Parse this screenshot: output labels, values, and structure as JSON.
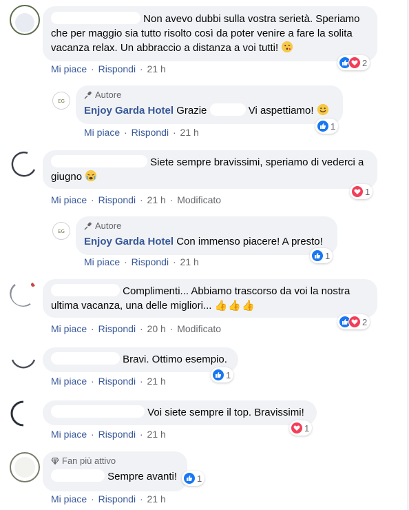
{
  "actions": {
    "like": "Mi piace",
    "reply": "Rispondi",
    "sep": "·",
    "edited": "Modificato"
  },
  "comments": [
    {
      "text": "Non avevo dubbi sulla vostra serietà. Speriamo che per maggio sia tutto risolto così da poter venire a fare la solita vacanza relax. Un abbraccio a distanza a voi tutti!",
      "time": "21 h",
      "reactions_count": "2",
      "reactions": [
        "like",
        "love"
      ],
      "reply": {
        "badge": "Autore",
        "page_name": "Enjoy Garda Hotel",
        "text_before": "Grazie",
        "text_after": "Vi aspettiamo!",
        "time": "21 h",
        "reactions_count": "1",
        "reactions": [
          "like"
        ]
      }
    },
    {
      "text": "Siete sempre bravissimi, speriamo di vederci a giugno",
      "time": "21 h",
      "edited": true,
      "reactions_count": "1",
      "reactions": [
        "love"
      ],
      "reply": {
        "badge": "Autore",
        "page_name": "Enjoy Garda Hotel",
        "text": "Con immenso piacere! A presto!",
        "time": "21 h",
        "reactions_count": "1",
        "reactions": [
          "like"
        ]
      }
    },
    {
      "text": "Complimenti... Abbiamo trascorso da voi la nostra ultima vacanza, una delle migliori...",
      "time": "20 h",
      "edited": true,
      "reactions_count": "2",
      "reactions": [
        "like",
        "love"
      ]
    },
    {
      "text": "Bravi. Ottimo esempio.",
      "time": "21 h",
      "reactions_count": "1",
      "reactions": [
        "like"
      ]
    },
    {
      "text": "Voi siete sempre il top. Bravissimi!",
      "time": "21 h",
      "reactions_count": "1",
      "reactions": [
        "love"
      ]
    },
    {
      "badge": "Fan più attivo",
      "text": "Sempre avanti!",
      "time": "21 h",
      "reactions_count": "1",
      "reactions": [
        "like"
      ]
    }
  ],
  "colors": {
    "link": "#385898",
    "bubble": "#f0f2f5",
    "meta": "#65676b",
    "like": "#1877f2",
    "love": "#f33e58"
  }
}
